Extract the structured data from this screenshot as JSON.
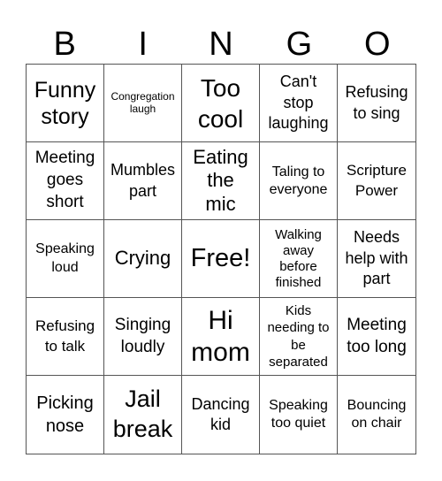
{
  "header": [
    "B",
    "I",
    "N",
    "G",
    "O"
  ],
  "cells": [
    "Funny story",
    "Congregation laugh",
    "Too cool",
    "Can't stop laughing",
    "Refusing to sing",
    "Meeting goes short",
    "Mumbles part",
    "Eating the mic",
    "Taling to everyone",
    "Scripture Power",
    "Speaking loud",
    "Crying",
    "Free!",
    "Walking away before finished",
    "Needs help with part",
    "Refusing to talk",
    "Singing loudly",
    "Hi mom",
    "Kids needing to be separated",
    "Meeting too long",
    "Picking nose",
    "Jail break",
    "Dancing kid",
    "Speaking too quiet",
    "Bouncing on chair"
  ]
}
